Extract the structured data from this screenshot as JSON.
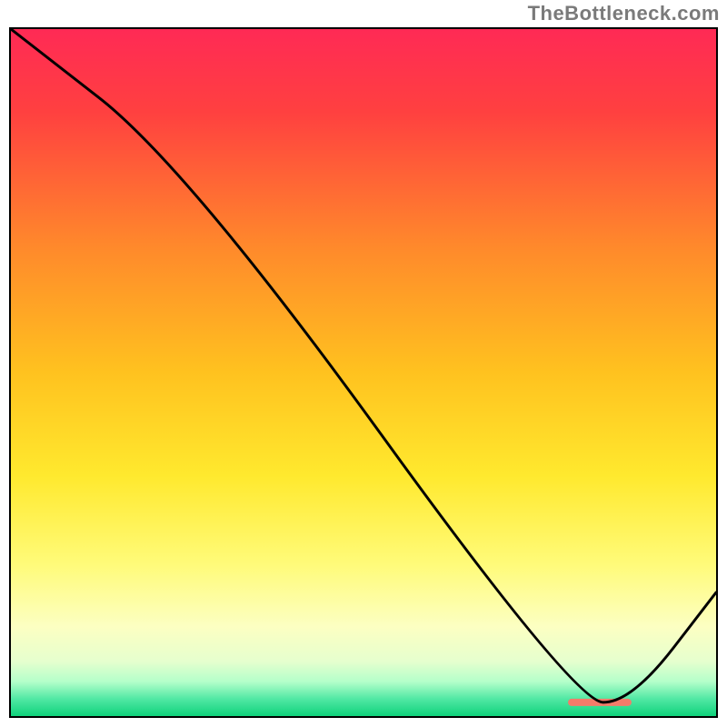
{
  "watermark": "TheBottleneck.com",
  "chart_data": {
    "type": "line",
    "title": "",
    "xlabel": "",
    "ylabel": "",
    "xlim": [
      0,
      100
    ],
    "ylim": [
      0,
      100
    ],
    "series": [
      {
        "name": "curve",
        "x": [
          0,
          25,
          80,
          88,
          100
        ],
        "y": [
          100,
          80,
          2,
          2,
          18
        ]
      }
    ],
    "annotations": [
      {
        "type": "rect",
        "x0": 79,
        "x1": 88,
        "y": 2,
        "color": "#f47b6a"
      }
    ],
    "gradient_stops": [
      {
        "offset": 0.0,
        "color": "#ff2a55"
      },
      {
        "offset": 0.12,
        "color": "#ff4040"
      },
      {
        "offset": 0.32,
        "color": "#ff8a2b"
      },
      {
        "offset": 0.5,
        "color": "#ffc21f"
      },
      {
        "offset": 0.65,
        "color": "#ffe92e"
      },
      {
        "offset": 0.78,
        "color": "#fffb7a"
      },
      {
        "offset": 0.87,
        "color": "#fcffc2"
      },
      {
        "offset": 0.92,
        "color": "#e6ffce"
      },
      {
        "offset": 0.95,
        "color": "#b4ffca"
      },
      {
        "offset": 0.975,
        "color": "#51e8a4"
      },
      {
        "offset": 1.0,
        "color": "#0fd27b"
      }
    ]
  }
}
